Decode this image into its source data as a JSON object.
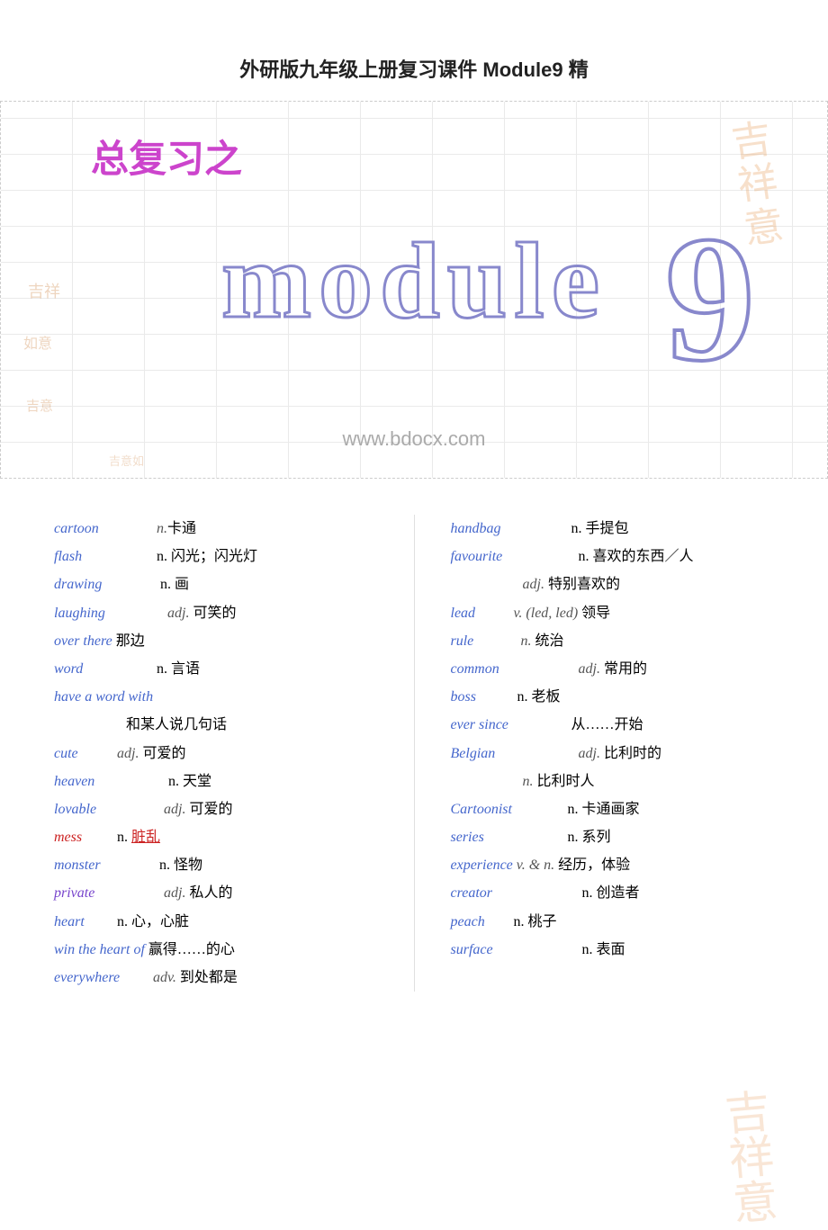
{
  "title": "外研版九年级上册复习课件 Module9 精",
  "banner": {
    "fuxi": "总复习之",
    "module_text": "module",
    "number": "9",
    "watermark": "www.bdocx.com"
  },
  "vocab_left": [
    {
      "en": "cartoon",
      "pos": "n.",
      "cn": "卡通",
      "color": "blue"
    },
    {
      "en": "flash",
      "pos": "n.",
      "cn": "闪光；闪光灯",
      "color": "blue"
    },
    {
      "en": "drawing",
      "pos": "n.",
      "cn": "画",
      "color": "blue"
    },
    {
      "en": "laughing",
      "pos": "adj.",
      "cn": "可笑的",
      "color": "blue"
    },
    {
      "en": "over there",
      "pos": "",
      "cn": "那边",
      "color": "blue"
    },
    {
      "en": "word",
      "pos": "n.",
      "cn": "言语",
      "color": "blue"
    },
    {
      "en": "have a word with",
      "pos": "",
      "cn": "",
      "color": "blue"
    },
    {
      "en": "",
      "pos": "",
      "cn": "和某人说几句话",
      "color": "blue",
      "indent": true
    },
    {
      "en": "cute",
      "pos": "adj.",
      "cn": "可爱的",
      "color": "blue"
    },
    {
      "en": "heaven",
      "pos": "n.",
      "cn": "天堂",
      "color": "blue"
    },
    {
      "en": "lovable",
      "pos": "adj.",
      "cn": "可爱的",
      "color": "blue"
    },
    {
      "en": "mess",
      "pos": "n.",
      "cn": "脏乱",
      "color": "red"
    },
    {
      "en": "monster",
      "pos": "n.",
      "cn": "怪物",
      "color": "blue"
    },
    {
      "en": "private",
      "pos": "adj.",
      "cn": "私人的",
      "color": "purple"
    },
    {
      "en": "heart",
      "pos": "n.",
      "cn": "心，心脏",
      "color": "blue"
    },
    {
      "en": "win the heart of",
      "pos": "",
      "cn": "赢得……的心",
      "color": "blue"
    },
    {
      "en": "everywhere",
      "pos": "adv.",
      "cn": "到处都是",
      "color": "blue"
    }
  ],
  "vocab_right": [
    {
      "en": "handbag",
      "pos": "n.",
      "cn": "手提包",
      "color": "blue"
    },
    {
      "en": "favourite",
      "pos": "n.",
      "cn": "喜欢的东西／人",
      "color": "blue"
    },
    {
      "en": "",
      "pos": "adj.",
      "cn": "特别喜欢的",
      "color": "blue",
      "indent": true
    },
    {
      "en": "lead",
      "pos": "v. (led, led)",
      "cn": "领导",
      "color": "blue"
    },
    {
      "en": "rule",
      "pos": "n.",
      "cn": "统治",
      "color": "blue"
    },
    {
      "en": "common",
      "pos": "adj.",
      "cn": "常用的",
      "color": "blue"
    },
    {
      "en": "boss",
      "pos": "n.",
      "cn": "老板",
      "color": "blue"
    },
    {
      "en": "ever since",
      "pos": "",
      "cn": "从……开始",
      "color": "blue"
    },
    {
      "en": "Belgian",
      "pos": "adj.",
      "cn": "比利时的",
      "color": "blue"
    },
    {
      "en": "",
      "pos": "n.",
      "cn": "比利时人",
      "color": "blue",
      "indent": true
    },
    {
      "en": "Cartoonist",
      "pos": "n.",
      "cn": "卡通画家",
      "color": "blue"
    },
    {
      "en": "series",
      "pos": "n.",
      "cn": "系列",
      "color": "blue"
    },
    {
      "en": "experience",
      "pos": "v. & n.",
      "cn": "经历，体验",
      "color": "blue"
    },
    {
      "en": "creator",
      "pos": "n.",
      "cn": "创造者",
      "color": "blue"
    },
    {
      "en": "peach",
      "pos": "n.",
      "cn": "桃子",
      "color": "blue"
    },
    {
      "en": "surface",
      "pos": "n.",
      "cn": "表面",
      "color": "blue"
    }
  ]
}
